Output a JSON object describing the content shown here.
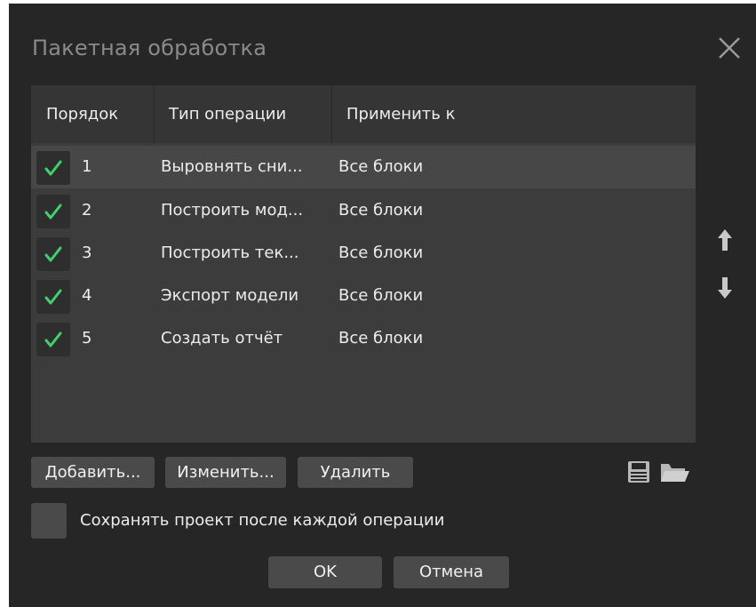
{
  "dialog": {
    "title": "Пакетная обработка",
    "close_icon": "close-icon"
  },
  "table": {
    "columns": [
      "Порядок",
      "Тип операции",
      "Применить к"
    ],
    "rows": [
      {
        "checked": true,
        "order": "1",
        "operation": "Выровнять сни...",
        "apply_to": "Все блоки"
      },
      {
        "checked": true,
        "order": "2",
        "operation": "Построить мод...",
        "apply_to": "Все блоки"
      },
      {
        "checked": true,
        "order": "3",
        "operation": "Построить тек...",
        "apply_to": "Все блоки"
      },
      {
        "checked": true,
        "order": "4",
        "operation": "Экспорт модели",
        "apply_to": "Все блоки"
      },
      {
        "checked": true,
        "order": "5",
        "operation": "Создать отчёт",
        "apply_to": "Все блоки"
      }
    ],
    "selected_row_index": 0
  },
  "side": {
    "move_up_icon": "arrow-up-icon",
    "move_down_icon": "arrow-down-icon"
  },
  "buttons": {
    "add": "Добавить...",
    "edit": "Изменить...",
    "delete": "Удалить",
    "save_icon": "save-icon",
    "open_icon": "folder-open-icon"
  },
  "options": {
    "save_after_each_label": "Сохранять проект после каждой операции",
    "save_after_each_checked": false
  },
  "footer": {
    "ok": "OK",
    "cancel": "Отмена"
  },
  "colors": {
    "dialog_bg": "#262626",
    "table_bg": "#3c3c3c",
    "selected_row": "#474747",
    "check_green": "#3fd16a",
    "button_bg": "#4a4a4a"
  }
}
